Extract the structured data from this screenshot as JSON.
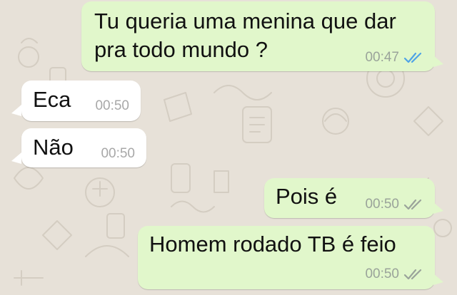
{
  "theme": {
    "outgoing_bubble": "#e1f7cb",
    "incoming_bubble": "#ffffff",
    "read_tick_color": "#4fa3e6",
    "delivered_tick_color": "#9aa39a"
  },
  "messages": [
    {
      "direction": "outgoing",
      "lines": [
        "Tu queria uma menina que dar",
        "pra todo mundo ?"
      ],
      "time": "00:47",
      "status": "read-double-check-icon"
    },
    {
      "direction": "incoming",
      "lines": [
        "Eca"
      ],
      "time": "00:50"
    },
    {
      "direction": "incoming",
      "lines": [
        "Não"
      ],
      "time": "00:50"
    },
    {
      "direction": "outgoing",
      "lines": [
        "Pois é"
      ],
      "time": "00:50",
      "status": "delivered-double-check-icon"
    },
    {
      "direction": "outgoing",
      "lines": [
        "Homem rodado TB é feio"
      ],
      "time": "00:50",
      "status": "delivered-double-check-icon"
    }
  ]
}
